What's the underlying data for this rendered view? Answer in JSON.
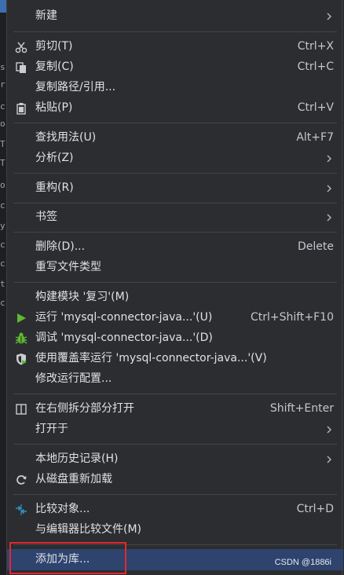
{
  "editor_strip": {
    "glyphs": [
      "s",
      "r",
      "c",
      "o",
      "T",
      "T",
      "o",
      "c",
      "y",
      "c",
      "c",
      "t",
      "c"
    ]
  },
  "menu": {
    "new": {
      "label": "新建"
    },
    "cut": {
      "label": "剪切(T)",
      "shortcut": "Ctrl+X",
      "icon": "scissors-icon"
    },
    "copy": {
      "label": "复制(C)",
      "shortcut": "Ctrl+C",
      "icon": "copy-icon"
    },
    "copy_path": {
      "label": "复制路径/引用..."
    },
    "paste": {
      "label": "粘贴(P)",
      "shortcut": "Ctrl+V",
      "icon": "clipboard-icon"
    },
    "find_usages": {
      "label": "查找用法(U)",
      "shortcut": "Alt+F7"
    },
    "analyze": {
      "label": "分析(Z)"
    },
    "refactor": {
      "label": "重构(R)"
    },
    "bookmarks": {
      "label": "书签"
    },
    "delete": {
      "label": "删除(D)...",
      "shortcut": "Delete"
    },
    "override_file_type": {
      "label": "重写文件类型"
    },
    "build_module": {
      "label": "构建模块 '复习'(M)"
    },
    "run": {
      "label": "运行 'mysql-connector-java...'(U)",
      "shortcut": "Ctrl+Shift+F10",
      "icon": "run-icon",
      "icon_color": "#5fb832"
    },
    "debug": {
      "label": "调试 'mysql-connector-java...'(D)",
      "icon": "debug-icon",
      "icon_color": "#5fb832"
    },
    "coverage": {
      "label": "使用覆盖率运行  'mysql-connector-java...'(V)",
      "icon": "coverage-icon"
    },
    "modify_run_config": {
      "label": "修改运行配置..."
    },
    "open_split": {
      "label": "在右侧拆分部分打开",
      "shortcut": "Shift+Enter",
      "icon": "split-icon"
    },
    "open_in": {
      "label": "打开于"
    },
    "local_history": {
      "label": "本地历史记录(H)"
    },
    "reload_from_disk": {
      "label": "从磁盘重新加载",
      "icon": "reload-icon"
    },
    "compare_with": {
      "label": "比较对象...",
      "shortcut": "Ctrl+D",
      "icon": "compare-icon",
      "icon_color": "#3592c4"
    },
    "compare_with_editor": {
      "label": "与编辑器比较文件(M)"
    },
    "add_as_library": {
      "label": "添加为库..."
    },
    "selection_color": "#2e436e",
    "highlight_color": "#e2282f"
  },
  "watermark": "CSDN @1886i"
}
